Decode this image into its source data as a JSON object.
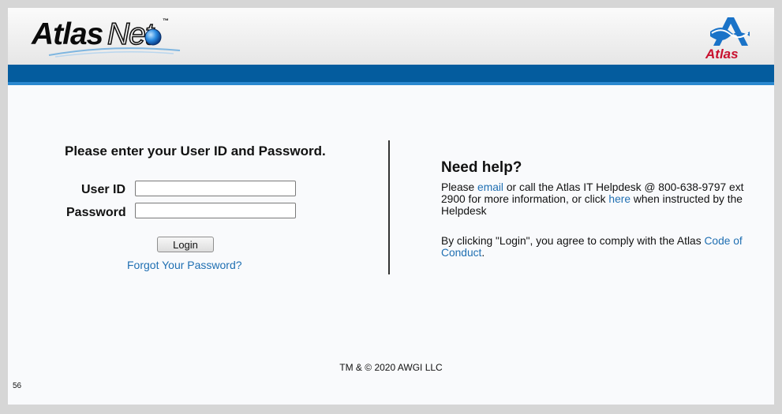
{
  "header": {
    "brand_primary": "Atlas",
    "brand_secondary": "Net",
    "brand_tm": "™",
    "corp_logo_text": "Atlas",
    "colors": {
      "header_bar": "#045c9e",
      "header_bar_accent": "#2b88cf",
      "corp_red": "#c8102e",
      "corp_blue": "#1a73c8",
      "link": "#1f6fb2"
    }
  },
  "login": {
    "heading": "Please enter your User ID and Password.",
    "userid_label": "User ID",
    "userid_value": "",
    "password_label": "Password",
    "password_value": "",
    "login_button": "Login",
    "forgot_link": "Forgot Your Password?"
  },
  "help": {
    "title": "Need help?",
    "p1_before": "Please ",
    "p1_link1": "email",
    "p1_middle": " or call the Atlas IT Helpdesk @ 800-638-9797 ext 2900 for more information, or click ",
    "p1_link2": "here",
    "p1_after": " when instructed by the Helpdesk",
    "p2_before": "By clicking \"Login\", you agree to comply with the Atlas ",
    "p2_link": "Code of Conduct",
    "p2_after": "."
  },
  "footer": {
    "copyright": "TM & © 2020 AWGI LLC",
    "page_number": "56"
  }
}
